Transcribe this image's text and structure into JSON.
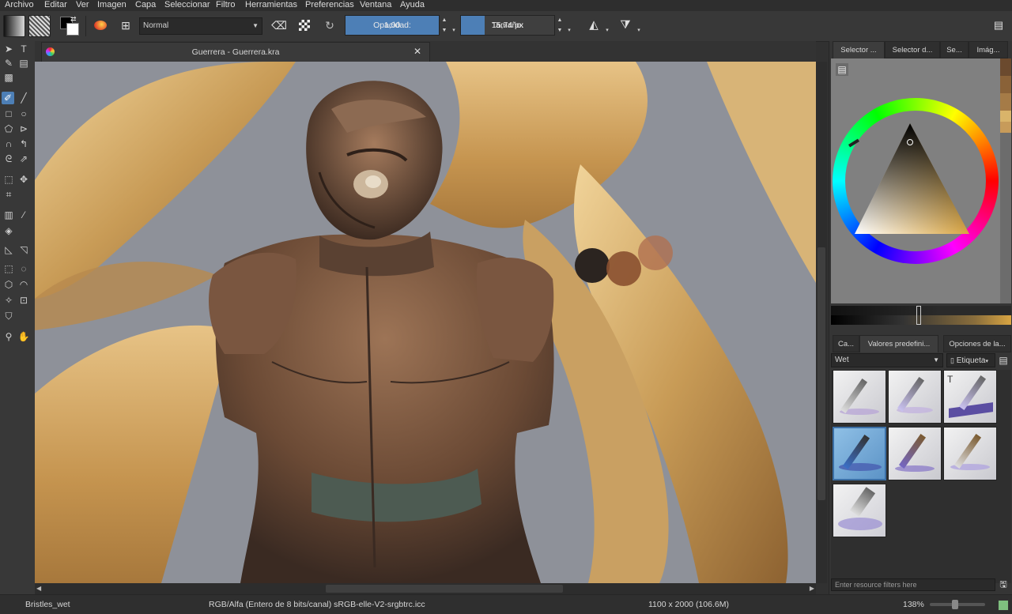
{
  "menu": [
    "Archivo",
    "Editar",
    "Ver",
    "Imagen",
    "Capa",
    "Seleccionar",
    "Filtro",
    "Herramientas",
    "Preferencias",
    "Ventana",
    "Ayuda"
  ],
  "toolbar": {
    "blend_mode": "Normal",
    "opacity_label": "Opacidad:",
    "opacity_value": "1,00",
    "size_label": "Tamaño:",
    "size_value": "15,74 px",
    "opacity_fraction": 1.0,
    "size_fraction": 0.25
  },
  "document": {
    "tab_title": "Guerrera - Guerrera.kra"
  },
  "dock": {
    "top_tabs": [
      "Selector ...",
      "Selector d...",
      "Se...",
      "Imág..."
    ],
    "bottom_tabs": [
      "Ca...",
      "Valores predefini...",
      "Opciones de la..."
    ],
    "preset_group": "Wet",
    "tag_label": "Etiqueta",
    "filter_placeholder": "Enter resource filters here",
    "swatch_colors": [
      "#6b4a2e",
      "#8a6238",
      "#a57b47",
      "#c79b5a",
      "#d9b46a"
    ],
    "selected_color": "#d9a542"
  },
  "status": {
    "brush": "Bristles_wet",
    "color_space": "RGB/Alfa (Entero de 8 bits/canal)  sRGB-elle-V2-srgbtrc.icc",
    "dimensions": "1100 x 2000 (106.6M)",
    "zoom": "138%"
  }
}
